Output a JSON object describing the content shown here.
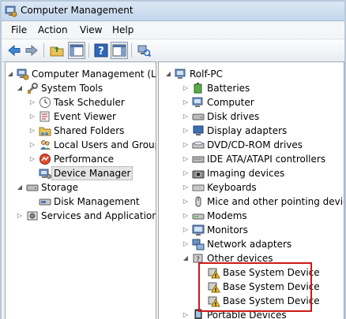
{
  "window": {
    "title": "Computer Management"
  },
  "menu": [
    "File",
    "Action",
    "View",
    "Help"
  ],
  "left_tree": {
    "root": "Computer Management (Local",
    "system_tools": "System Tools",
    "system_tools_items": [
      "Task Scheduler",
      "Event Viewer",
      "Shared Folders",
      "Local Users and Groups",
      "Performance",
      "Device Manager"
    ],
    "storage": "Storage",
    "disk_management": "Disk Management",
    "services": "Services and Applications"
  },
  "right_tree": {
    "root": "Rolf-PC",
    "categories": [
      "Batteries",
      "Computer",
      "Disk drives",
      "Display adapters",
      "DVD/CD-ROM drives",
      "IDE ATA/ATAPI controllers",
      "Imaging devices",
      "Keyboards",
      "Mice and other pointing devices",
      "Modems",
      "Monitors",
      "Network adapters"
    ],
    "other_devices": "Other devices",
    "other_children": [
      "Base System Device",
      "Base System Device",
      "Base System Device"
    ],
    "portable": "Portable Devices"
  },
  "colors": {
    "highlight_border": "#cc1818",
    "selection": "#e4e4e4"
  }
}
